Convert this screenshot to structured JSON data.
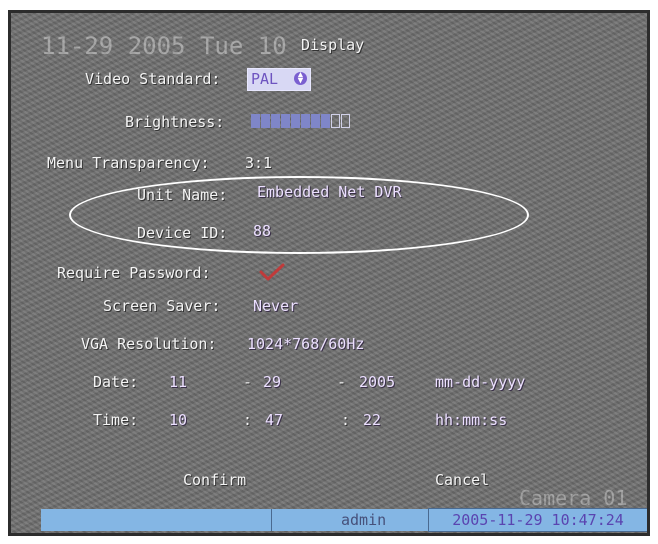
{
  "osd": {
    "ghost_datetime": "11-29 2005 Tue 10",
    "ghost_camera": "Camera 01"
  },
  "title": "Display",
  "video_standard": {
    "label": "Video Standard:",
    "value": "PAL"
  },
  "brightness": {
    "label": "Brightness:",
    "level_segments_filled": 8,
    "level_segments_total": 10
  },
  "menu_transparency": {
    "label": "Menu Transparency:",
    "value": "3:1"
  },
  "unit_name": {
    "label": "Unit Name:",
    "value": "Embedded Net DVR"
  },
  "device_id": {
    "label": "Device ID:",
    "value": "88"
  },
  "require_password": {
    "label": "Require Password:",
    "checked": true
  },
  "screen_saver": {
    "label": "Screen Saver:",
    "value": "Never"
  },
  "vga_resolution": {
    "label": "VGA Resolution:",
    "value": "1024*768/60Hz"
  },
  "date": {
    "label": "Date:",
    "month": "11",
    "day": "29",
    "year": "2005",
    "sep": "-",
    "format": "mm-dd-yyyy"
  },
  "time": {
    "label": "Time:",
    "hour": "10",
    "minute": "47",
    "second": "22",
    "sep": ":",
    "format": "hh:mm:ss"
  },
  "buttons": {
    "confirm": "Confirm",
    "cancel": "Cancel"
  },
  "status_bar": {
    "user": "admin",
    "datetime": "2005-11-29 10:47:24"
  },
  "colors": {
    "status_bar": "#84b6e4",
    "highlight": "#d8d8f4",
    "accent": "#7a5fd0",
    "annotation": "#ffffff"
  }
}
